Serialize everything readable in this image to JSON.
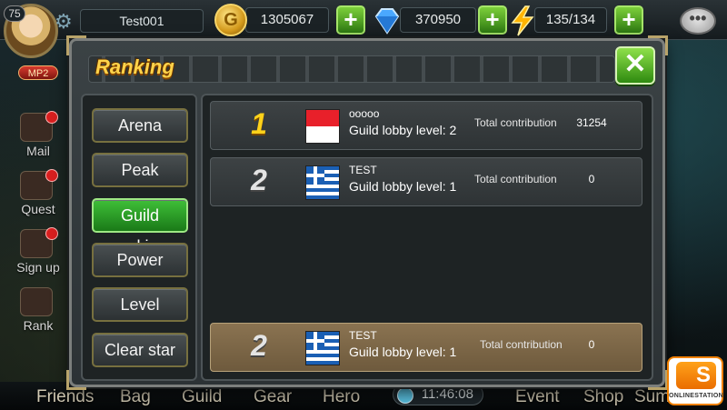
{
  "player": {
    "level": "75",
    "vip": "MP2",
    "name": "Test001"
  },
  "resources": {
    "gold": "1305067",
    "diamonds": "370950",
    "energy": "135/134"
  },
  "side_menu": [
    {
      "label": "Mail"
    },
    {
      "label": "Quest"
    },
    {
      "label": "Sign up"
    },
    {
      "label": "Rank"
    }
  ],
  "bottom_nav": {
    "friends": "Friends",
    "bag": "Bag",
    "guild": "Guild",
    "gear": "Gear",
    "hero": "Hero",
    "clock": "11:46:08",
    "event": "Event",
    "shop": "Shop",
    "sum": "Sum"
  },
  "logo": {
    "letter": "S",
    "text": "ONLINESTATION"
  },
  "modal": {
    "title": "Ranking",
    "tabs": [
      "Arena",
      "Peak",
      "Guild ranking",
      "Power",
      "Level",
      "Clear star"
    ],
    "active_tab": "Guild ranking",
    "contribution_label": "Total contribution",
    "rows": [
      {
        "rank": "1",
        "flag": "indonesia",
        "guild": "ooooo",
        "lobby": "Guild lobby level: 2",
        "contribution": "31254"
      },
      {
        "rank": "2",
        "flag": "greece",
        "guild": "TEST",
        "lobby": "Guild lobby level: 1",
        "contribution": "0"
      }
    ],
    "my_row": {
      "rank": "2",
      "flag": "greece",
      "guild": "TEST",
      "lobby": "Guild lobby level: 1",
      "contribution": "0"
    }
  },
  "colors": {
    "active_tab": "#2fa82a",
    "rank_gold": "#ffd21a",
    "my_row": "#7d6848",
    "close_button": "#5cbf2c"
  }
}
